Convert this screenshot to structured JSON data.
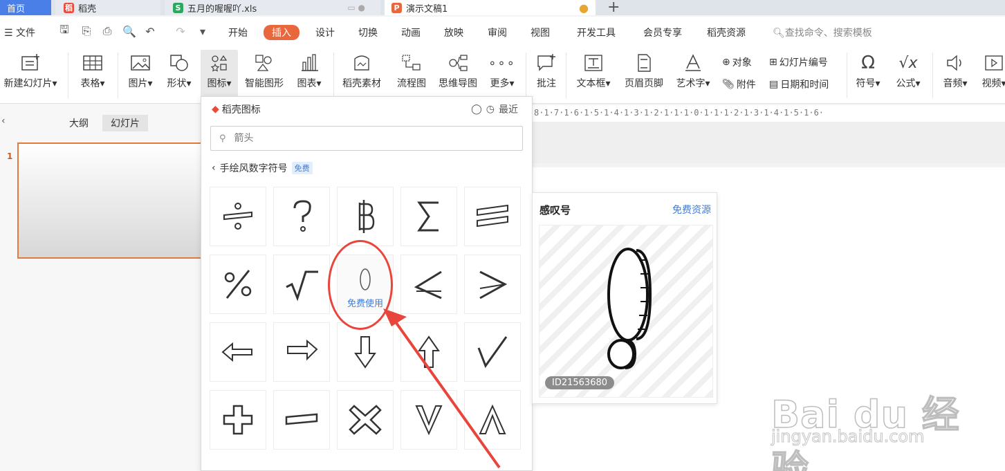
{
  "tabs": {
    "home": "首页",
    "docer": "稻壳",
    "xls": "五月的喔喔吖.xls",
    "ppt": "演示文稿1",
    "plus": "+"
  },
  "menu": {
    "file": "文件",
    "items": [
      "开始",
      "插入",
      "设计",
      "切换",
      "动画",
      "放映",
      "审阅",
      "视图",
      "开发工具",
      "会员专享",
      "稻壳资源"
    ],
    "active": "插入",
    "search": "查找命令、搜索模板"
  },
  "ribbon": {
    "new_slide": "新建幻灯片",
    "table": "表格",
    "image": "图片",
    "shape": "形状",
    "icon": "图标",
    "smart": "智能图形",
    "chart": "图表",
    "docer_material": "稻壳素材",
    "flowchart": "流程图",
    "mindmap": "思维导图",
    "more": "更多",
    "comment": "批注",
    "textbox": "文本框",
    "header_footer": "页眉页脚",
    "wordart": "艺术字",
    "object": "对象",
    "attachment": "附件",
    "slide_number": "幻灯片编号",
    "datetime": "日期和时间",
    "symbol": "符号",
    "formula": "公式",
    "audio": "音频",
    "video": "视频"
  },
  "left_panel": {
    "tab_outline": "大纲",
    "tab_slides": "幻灯片",
    "slide_number": "1"
  },
  "ruler": "8·1·7·1·6·1·5·1·4·1·3·1·2·1·1·1·0·1·1·1·2·1·3·1·4·1·5·1·6·",
  "dropdown": {
    "title": "稻壳图标",
    "recent": "最近",
    "search_placeholder": "箭头",
    "category": "手绘风数字符号",
    "free_badge": "免费",
    "hover_label": "免费使用",
    "icons": [
      "divide-icon",
      "question-mark-icon",
      "baht-icon",
      "sigma-icon",
      "equals-icon",
      "percent-icon",
      "square-root-icon",
      "zero-icon",
      "less-than-icon",
      "greater-than-icon",
      "left-arrow-icon",
      "right-arrow-icon",
      "down-arrow-icon",
      "up-arrow-icon",
      "check-mark-icon",
      "plus-icon",
      "minus-icon",
      "times-icon",
      "v-letter-icon",
      "lambda-icon"
    ]
  },
  "preview": {
    "title": "感叹号",
    "link": "免费资源",
    "id": "ID21563680"
  },
  "watermark": {
    "logo": "Bai du 经验",
    "url": "jingyan.baidu.com"
  }
}
